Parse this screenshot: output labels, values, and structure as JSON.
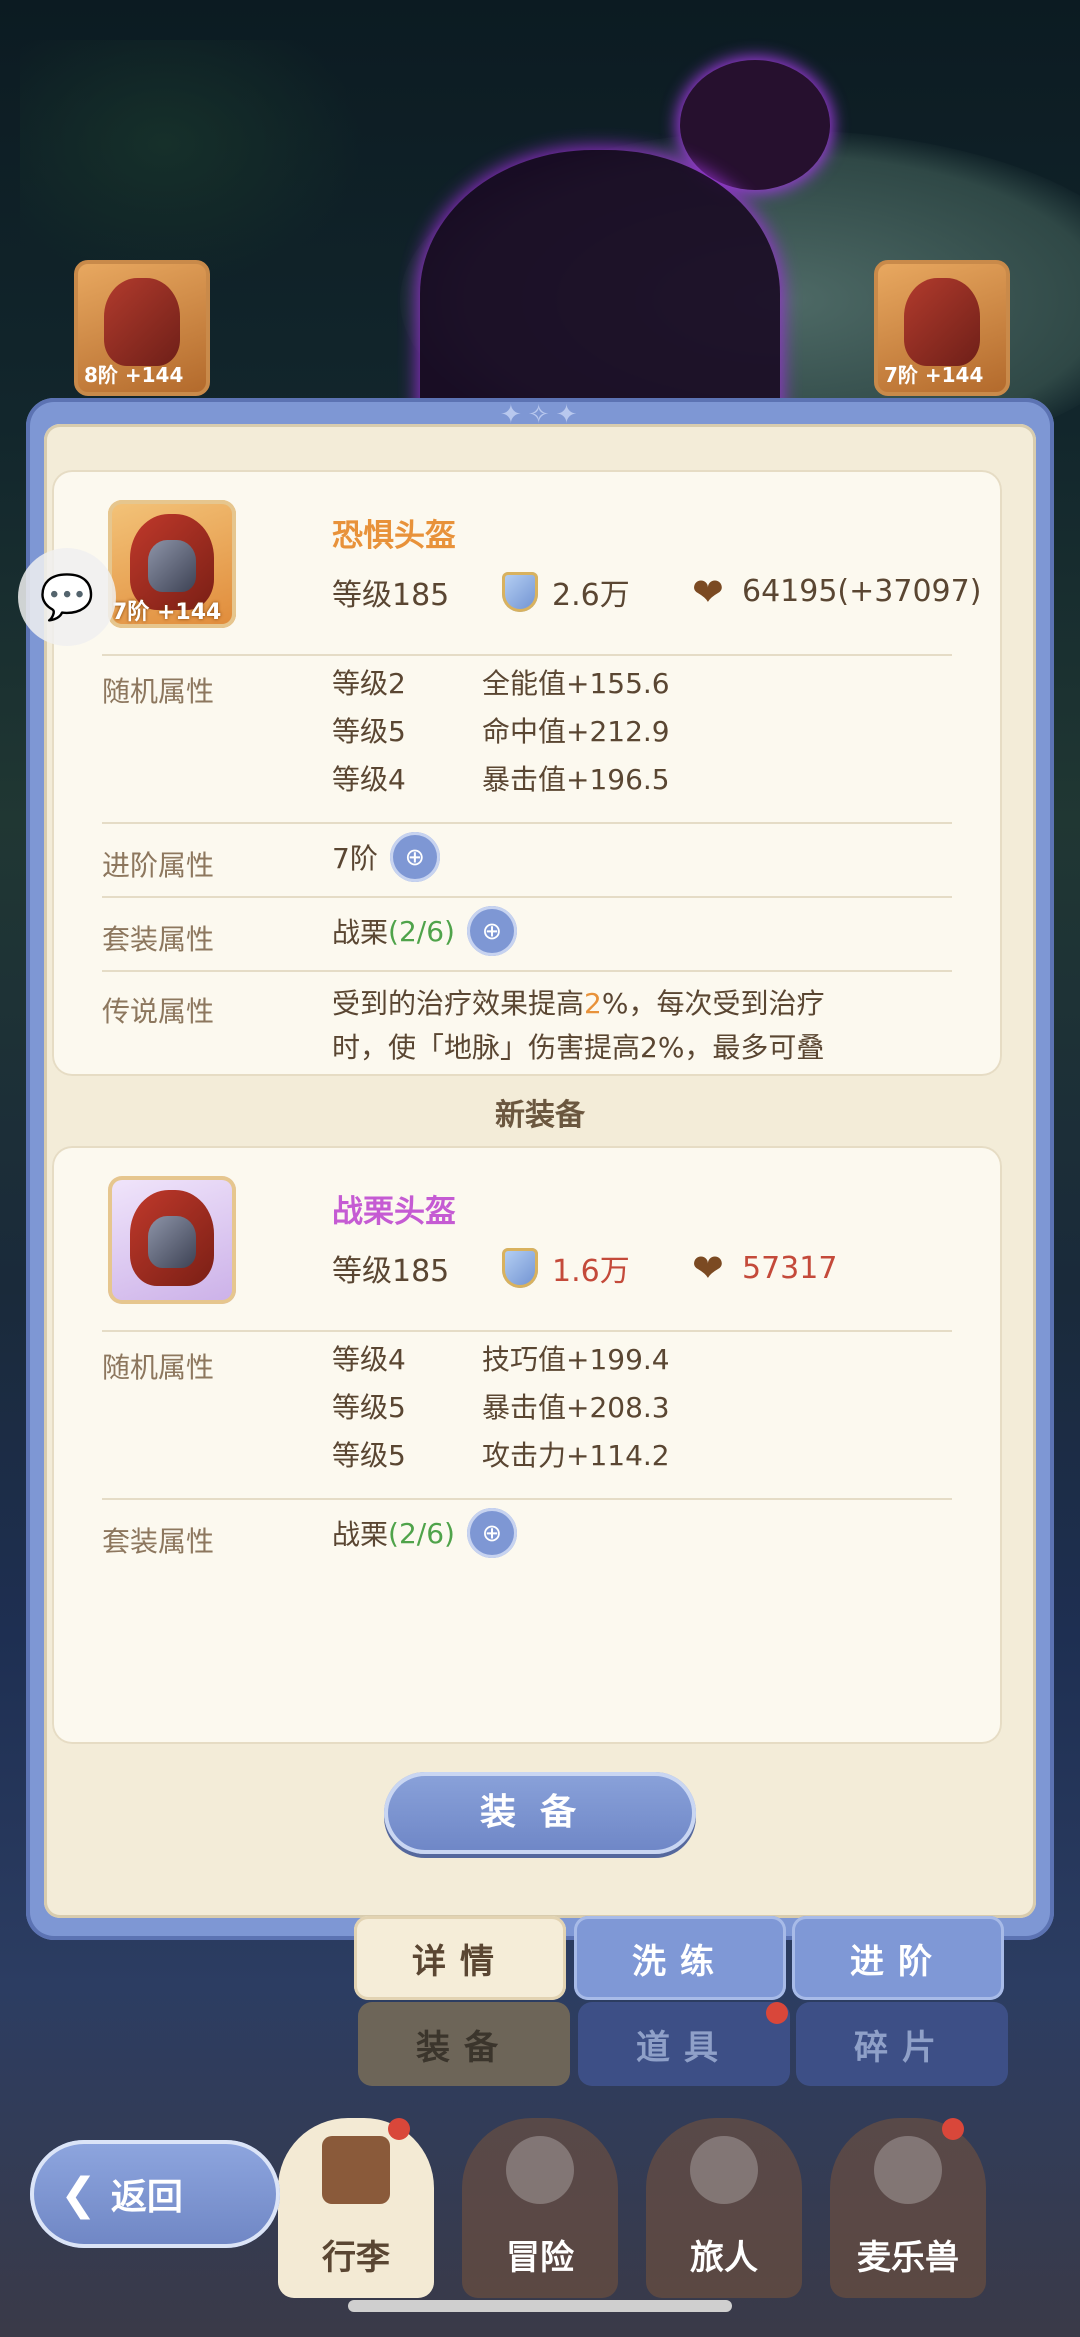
{
  "scene": {
    "left_card_badge": "8阶 +144",
    "right_card_badge": "7阶 +144"
  },
  "current_item": {
    "name": "恐惧头盔",
    "stage_badge": "7阶 +144",
    "level": "等级185",
    "power": "2.6万",
    "hp": "64195(+37097)",
    "random_label": "随机属性",
    "random_attrs": [
      {
        "level": "等级2",
        "value": "全能值+155.6"
      },
      {
        "level": "等级5",
        "value": "命中值+212.9"
      },
      {
        "level": "等级4",
        "value": "暴击值+196.5"
      }
    ],
    "advance_label": "进阶属性",
    "advance_value": "7阶",
    "set_label": "套装属性",
    "set_name": "战栗",
    "set_count": "(2/6)",
    "legend_label": "传说属性",
    "legend_line1_a": "受到的治疗效果提高",
    "legend_line1_num": "2",
    "legend_line1_b": "%，每次受到治疗",
    "legend_line2": "时，使「地脉」伤害提高2%，最多可叠"
  },
  "new_section_title": "新装备",
  "new_item": {
    "name": "战栗头盔",
    "level": "等级185",
    "power": "1.6万",
    "hp": "57317",
    "random_label": "随机属性",
    "random_attrs": [
      {
        "level": "等级4",
        "value": "技巧值+199.4"
      },
      {
        "level": "等级5",
        "value": "暴击值+208.3"
      },
      {
        "level": "等级5",
        "value": "攻击力+114.2"
      }
    ],
    "set_label": "套装属性",
    "set_name": "战栗",
    "set_count": "(2/6)"
  },
  "equip_button": "装备",
  "tabs_row1": [
    "详情",
    "洗练",
    "进阶"
  ],
  "tabs_row2": [
    "装备",
    "道具",
    "碎片"
  ],
  "back_button": "返回",
  "bottom_nav": [
    "行李",
    "冒险",
    "旅人",
    "麦乐兽"
  ],
  "colors": {
    "accent_blue": "#7e97d4",
    "orange_name": "#e8923a",
    "purple_name": "#c55bd3",
    "red_value": "#c44a3a",
    "set_green": "#4fa34a"
  }
}
